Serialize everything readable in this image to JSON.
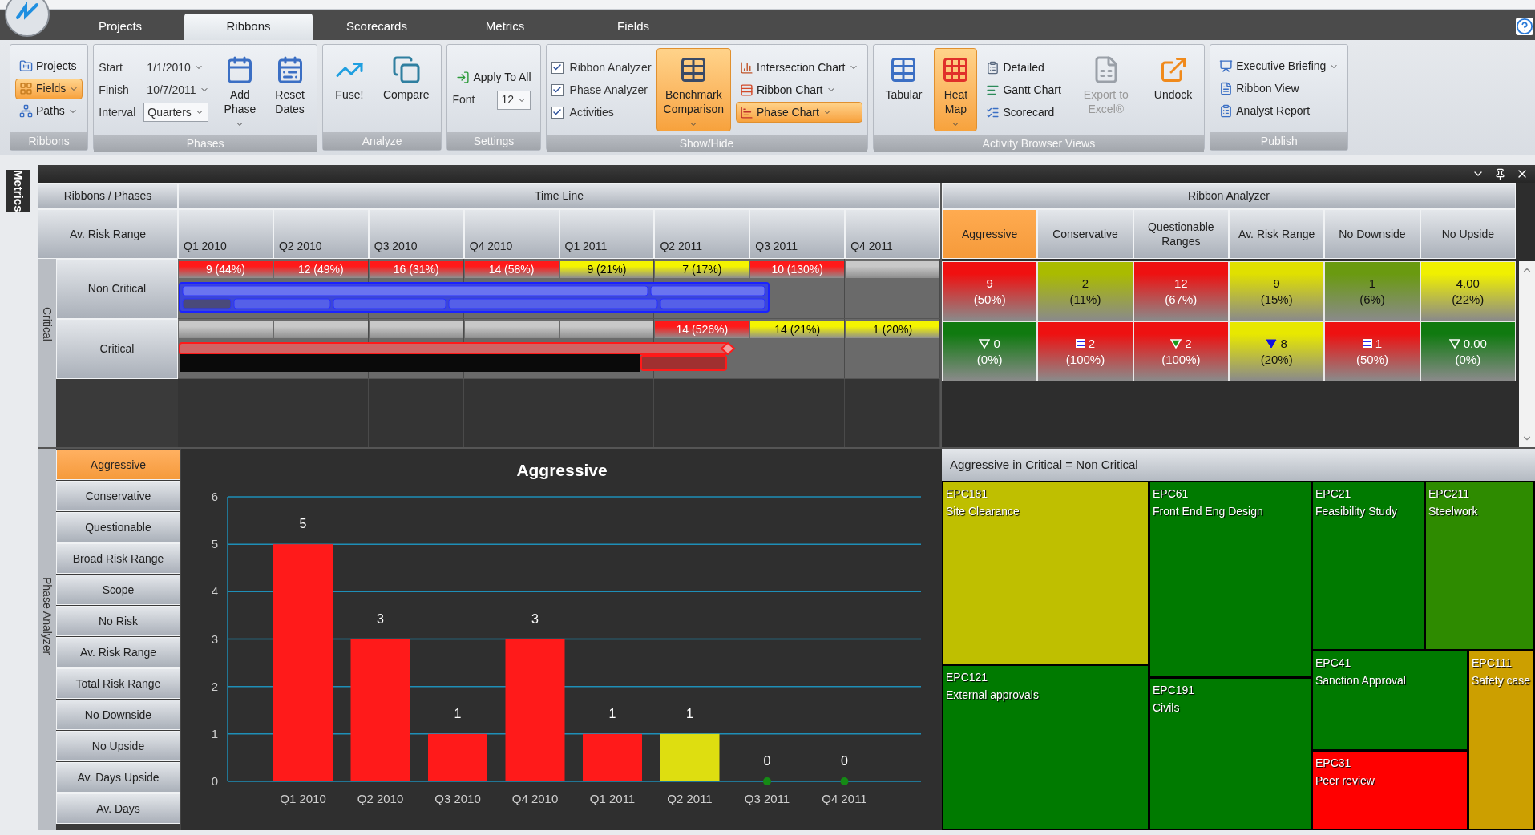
{
  "app": {
    "tabs": [
      {
        "label": "Projects",
        "selected": false
      },
      {
        "label": "Ribbons",
        "selected": true
      },
      {
        "label": "Scorecards",
        "selected": false
      },
      {
        "label": "Metrics",
        "selected": false
      },
      {
        "label": "Fields",
        "selected": false
      }
    ]
  },
  "ribbon": {
    "groups": [
      {
        "label": "Ribbons",
        "controls": [
          {
            "kind": "small",
            "label": "Projects",
            "selected": false,
            "menu": false,
            "disabled": false
          },
          {
            "kind": "small",
            "label": "Fields",
            "selected": true,
            "menu": true,
            "disabled": false
          },
          {
            "kind": "small",
            "label": "Paths",
            "selected": false,
            "menu": true,
            "disabled": false
          }
        ]
      },
      {
        "label": "Phases",
        "controls": [
          {
            "kind": "field",
            "label": "Start",
            "value": "1/1/2010",
            "boxed": false
          },
          {
            "kind": "field",
            "label": "Finish",
            "value": "10/7/2011",
            "boxed": false
          },
          {
            "kind": "field",
            "label": "Interval",
            "value": "Quarters",
            "boxed": true
          },
          {
            "kind": "large",
            "label": "Add Phase",
            "selected": false,
            "menu": true,
            "disabled": false
          },
          {
            "kind": "large",
            "label": "Reset Dates",
            "selected": false,
            "menu": false,
            "disabled": false
          }
        ]
      },
      {
        "label": "Analyze",
        "controls": [
          {
            "kind": "large",
            "label": "Fuse!",
            "selected": false,
            "menu": false,
            "disabled": false
          },
          {
            "kind": "large",
            "label": "Compare",
            "selected": false,
            "menu": false,
            "disabled": false
          }
        ]
      },
      {
        "label": "Settings",
        "controls": [
          {
            "kind": "small",
            "label": "Apply To All",
            "selected": false,
            "menu": false,
            "disabled": false
          },
          {
            "kind": "field",
            "label": "Font",
            "value": "12",
            "boxed": true
          }
        ]
      },
      {
        "label": "Show/Hide",
        "controls": [
          {
            "kind": "checkbox",
            "label": "Ribbon Analyzer",
            "checked": true
          },
          {
            "kind": "checkbox",
            "label": "Phase Analyzer",
            "checked": true
          },
          {
            "kind": "checkbox",
            "label": "Activities",
            "checked": true
          },
          {
            "kind": "large",
            "label": "Benchmark Comparison",
            "selected": true,
            "menu": true,
            "disabled": false
          },
          {
            "kind": "small",
            "label": "Intersection Chart",
            "selected": false,
            "menu": true,
            "disabled": false
          },
          {
            "kind": "small",
            "label": "Ribbon Chart",
            "selected": false,
            "menu": true,
            "disabled": false
          },
          {
            "kind": "small",
            "label": "Phase Chart",
            "selected": true,
            "menu": true,
            "disabled": false
          }
        ]
      },
      {
        "label": "Activity Browser Views",
        "controls": [
          {
            "kind": "large",
            "label": "Tabular",
            "selected": false,
            "menu": false,
            "disabled": false
          },
          {
            "kind": "large",
            "label": "Heat Map",
            "selected": true,
            "menu": true,
            "disabled": false
          },
          {
            "kind": "small",
            "label": "Detailed",
            "selected": false,
            "menu": false,
            "disabled": false
          },
          {
            "kind": "small",
            "label": "Gantt Chart",
            "selected": false,
            "menu": false,
            "disabled": false
          },
          {
            "kind": "small",
            "label": "Scorecard",
            "selected": false,
            "menu": false,
            "disabled": false
          },
          {
            "kind": "large",
            "label": "Export to Excel®",
            "selected": false,
            "menu": false,
            "disabled": true
          },
          {
            "kind": "large",
            "label": "Undock",
            "selected": false,
            "menu": false,
            "disabled": false
          }
        ]
      },
      {
        "label": "Publish",
        "controls": [
          {
            "kind": "small",
            "label": "Executive Briefing",
            "selected": false,
            "menu": true,
            "disabled": false
          },
          {
            "kind": "small",
            "label": "Ribbon View",
            "selected": false,
            "menu": false,
            "disabled": false
          },
          {
            "kind": "small",
            "label": "Analyst Report",
            "selected": false,
            "menu": false,
            "disabled": false
          }
        ]
      }
    ]
  },
  "side_tab": "Metrics",
  "timeline": {
    "corner_label": "Ribbons / Phases",
    "title": "Time Line",
    "row_header": "Av. Risk Range",
    "group_label": "Critical",
    "periods": [
      "Q1 2010",
      "Q2 2010",
      "Q3 2010",
      "Q4 2010",
      "Q1 2011",
      "Q2 2011",
      "Q3 2011",
      "Q4 2011"
    ],
    "rows": [
      {
        "label": "Non Critical",
        "cells": [
          {
            "text": "9 (44%)",
            "color": "#ff1a1a"
          },
          {
            "text": "12 (49%)",
            "color": "#ff1a1a"
          },
          {
            "text": "16 (31%)",
            "color": "#ff1a1a"
          },
          {
            "text": "14 (58%)",
            "color": "#ff1a1a"
          },
          {
            "text": "9 (21%)",
            "color": "#f4f400"
          },
          {
            "text": "7 (17%)",
            "color": "#f4f400"
          },
          {
            "text": "10 (130%)",
            "color": "#ff1a1a"
          },
          {
            "color": "#c8c8c8"
          }
        ]
      },
      {
        "label": "Critical",
        "cells": [
          {
            "color": "#c8c8c8"
          },
          {
            "color": "#c8c8c8"
          },
          {
            "color": "#c8c8c8"
          },
          {
            "color": "#c8c8c8"
          },
          {
            "color": "#c8c8c8"
          },
          {
            "text": "14 (526%)",
            "color": "#ff1a1a"
          },
          {
            "text": "14 (21%)",
            "color": "#f4f400"
          },
          {
            "text": "1 (20%)",
            "color": "#f4f400"
          }
        ]
      }
    ]
  },
  "analyzer": {
    "title": "Ribbon Analyzer",
    "columns": [
      {
        "label": "Aggressive",
        "selected": true
      },
      {
        "label": "Conservative",
        "selected": false
      },
      {
        "label": "Questionable Ranges",
        "selected": false
      },
      {
        "label": "Av. Risk Range",
        "selected": false
      },
      {
        "label": "No Downside",
        "selected": false
      },
      {
        "label": "No Upside",
        "selected": false
      }
    ],
    "rows": [
      {
        "cells": [
          {
            "kind": "plain",
            "value": "9",
            "percent": "(50%)",
            "color": "#f01010"
          },
          {
            "kind": "plain",
            "value": "2",
            "percent": "(11%)",
            "color": "#aabb00"
          },
          {
            "kind": "plain",
            "value": "12",
            "percent": "(67%)",
            "color": "#ee1111"
          },
          {
            "kind": "plain",
            "value": "9",
            "percent": "(15%)",
            "color": "#e0e000"
          },
          {
            "kind": "plain",
            "value": "1",
            "percent": "(6%)",
            "color": "#6a9a10"
          },
          {
            "kind": "plain",
            "value": "4.00",
            "percent": "(22%)",
            "color": "#f0f000"
          }
        ]
      },
      {
        "cells": [
          {
            "kind": "hollow",
            "value": "0",
            "percent": "(0%)",
            "color": "#107a10"
          },
          {
            "kind": "equal",
            "value": "2",
            "percent": "(100%)",
            "color": "#ee1111"
          },
          {
            "kind": "green",
            "value": "2",
            "percent": "(100%)",
            "color": "#ee1111"
          },
          {
            "kind": "filled",
            "value": "8",
            "percent": "(20%)",
            "color": "#e8e800"
          },
          {
            "kind": "equal",
            "value": "1",
            "percent": "(50%)",
            "color": "#ee1111"
          },
          {
            "kind": "hollow",
            "value": "0.00",
            "percent": "(0%)",
            "color": "#107a10"
          }
        ]
      }
    ]
  },
  "phase_analyzer": {
    "label": "Phase Analyzer",
    "items": [
      {
        "label": "Aggressive",
        "selected": true
      },
      {
        "label": "Conservative",
        "selected": false
      },
      {
        "label": "Questionable",
        "selected": false
      },
      {
        "label": "Broad Risk Range",
        "selected": false
      },
      {
        "label": "Scope",
        "selected": false
      },
      {
        "label": "No Risk",
        "selected": false
      },
      {
        "label": "Av. Risk Range",
        "selected": false
      },
      {
        "label": "Total Risk Range",
        "selected": false
      },
      {
        "label": "No Downside",
        "selected": false
      },
      {
        "label": "No Upside",
        "selected": false
      },
      {
        "label": "Av. Days Upside",
        "selected": false
      },
      {
        "label": "Av. Days",
        "selected": false
      }
    ]
  },
  "chart": {
    "chart_data": {
      "type": "bar",
      "title": "Aggressive",
      "categories": [
        "Q1 2010",
        "Q2 2010",
        "Q3 2010",
        "Q4 2010",
        "Q1 2011",
        "Q2 2011",
        "Q3 2011",
        "Q4 2011"
      ],
      "series": [
        {
          "color": "#ff1a1a",
          "values": [
            5,
            3,
            1,
            3,
            1,
            null,
            null,
            null
          ]
        },
        {
          "color": "#dede10",
          "values": [
            null,
            null,
            null,
            null,
            null,
            1,
            null,
            null
          ]
        },
        {
          "color": "#158a15",
          "values": [
            null,
            null,
            null,
            null,
            null,
            null,
            0,
            0
          ]
        }
      ],
      "ylim": [
        0,
        6
      ],
      "yticks": [
        0,
        1,
        2,
        3,
        4,
        5,
        6
      ],
      "grid": true,
      "data_labels": true
    }
  },
  "treemap": {
    "title": "Aggressive in Critical = Non Critical",
    "tiles": [
      {
        "code": "EPC181",
        "name": "Site Clearance",
        "color": "#bfbf00"
      },
      {
        "code": "EPC121",
        "name": "External approvals",
        "color": "#007a00"
      },
      {
        "code": "EPC61",
        "name": "Front End Eng Design",
        "color": "#007a00"
      },
      {
        "code": "EPC191",
        "name": "Civils",
        "color": "#007a00"
      },
      {
        "code": "EPC21",
        "name": "Feasibility Study",
        "color": "#007a00"
      },
      {
        "code": "EPC211",
        "name": "Steelwork",
        "color": "#2e8b00"
      },
      {
        "code": "EPC41",
        "name": "Sanction Approval",
        "color": "#007a00"
      },
      {
        "code": "EPC31",
        "name": "Peer review",
        "color": "#ff0000"
      },
      {
        "code": "EPC111",
        "name": "Safety case",
        "color": "#cc9f00"
      }
    ]
  }
}
